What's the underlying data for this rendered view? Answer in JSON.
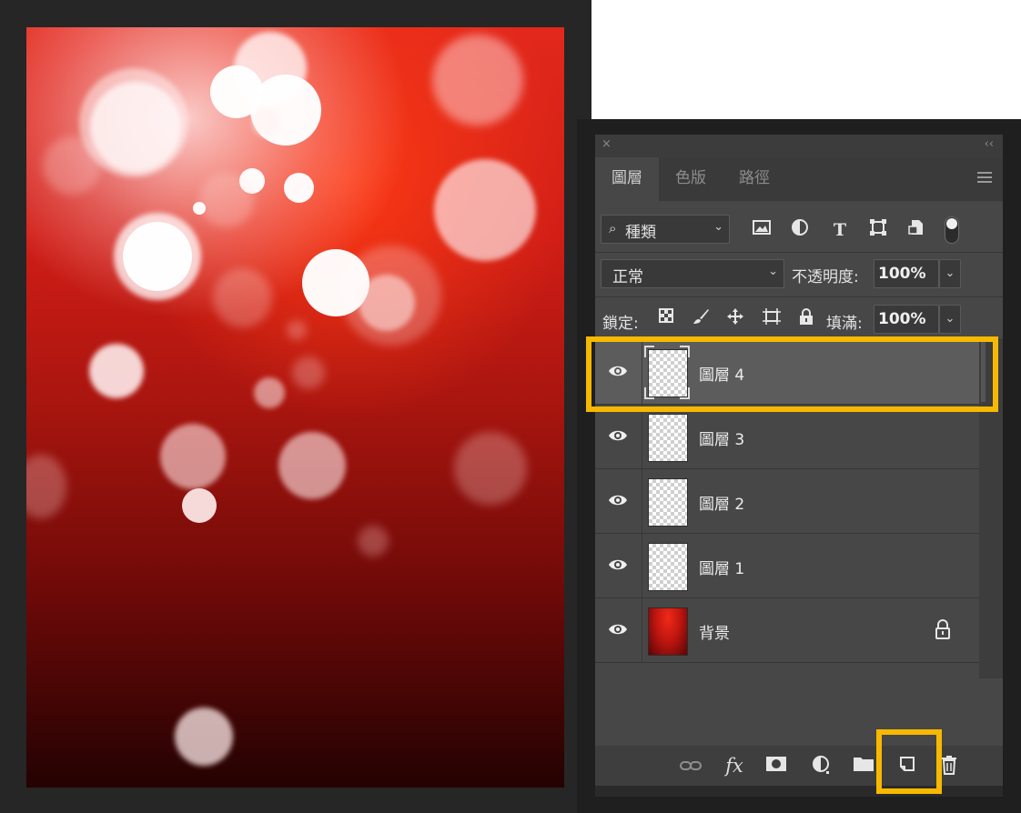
{
  "canvas": {
    "background_colors": [
      "#e2281c",
      "#a8150f",
      "#240202"
    ]
  },
  "panel": {
    "close_glyph": "×",
    "collapse_glyph": "‹‹",
    "tabs": [
      {
        "label": "圖層",
        "active": true
      },
      {
        "label": "色版",
        "active": false
      },
      {
        "label": "路徑",
        "active": false
      }
    ],
    "menu_icon": "hamburger-icon",
    "filter": {
      "search_glyph": "⌕",
      "label": "種類",
      "icons": [
        "image-filter-icon",
        "adjustment-filter-icon",
        "type-filter-icon",
        "shape-filter-icon",
        "smart-object-filter-icon"
      ]
    },
    "blend_mode": "正常",
    "opacity_label": "不透明度:",
    "opacity_value": "100%",
    "lock_label": "鎖定:",
    "lock_icons": [
      "lock-transparent-pixels-icon",
      "lock-image-pixels-icon",
      "lock-position-icon",
      "lock-artboard-icon",
      "lock-all-icon"
    ],
    "fill_label": "填滿:",
    "fill_value": "100%",
    "layers": [
      {
        "name": "圖層 4",
        "selected": true,
        "visible": true,
        "locked": false
      },
      {
        "name": "圖層 3",
        "selected": false,
        "visible": true,
        "locked": false
      },
      {
        "name": "圖層 2",
        "selected": false,
        "visible": true,
        "locked": false
      },
      {
        "name": "圖層 1",
        "selected": false,
        "visible": true,
        "locked": false
      },
      {
        "name": "背景",
        "selected": false,
        "visible": true,
        "locked": true
      }
    ],
    "bottom_icons": [
      "link-layers-icon",
      "fx-icon",
      "layer-mask-icon",
      "adjustment-layer-icon",
      "new-group-icon",
      "new-layer-icon",
      "delete-layer-icon"
    ],
    "fx_label": "fx"
  },
  "highlight_color": "#f6b800"
}
